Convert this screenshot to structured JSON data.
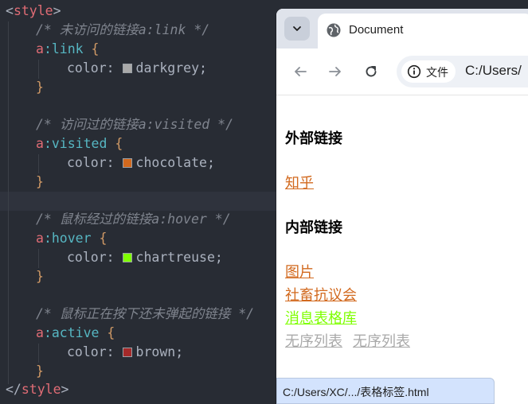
{
  "editor": {
    "lines": {
      "l1": {
        "open": "<",
        "tag": "style",
        "close": ">"
      },
      "l2": {
        "comment": "/* 未访问的链接a:link */"
      },
      "l3": {
        "el": "a",
        "pseudo": ":link",
        "brace": " {"
      },
      "l4": {
        "prop": "color: ",
        "value": "darkgrey;",
        "swatch": "#a9a9a9"
      },
      "l5": {
        "brace": "}"
      },
      "l6": {
        "comment": "/* 访问过的链接a:visited */"
      },
      "l7": {
        "el": "a",
        "pseudo": ":visited",
        "brace": " {"
      },
      "l8": {
        "prop": "color: ",
        "value": "chocolate;",
        "swatch": "#d2691e"
      },
      "l9": {
        "brace": "}"
      },
      "l10": {
        "comment": "/* 鼠标经过的链接a:hover */"
      },
      "l11": {
        "el": "a",
        "pseudo": ":hover",
        "brace": " {"
      },
      "l12": {
        "prop": "color: ",
        "value": "chartreuse;",
        "swatch": "#7fff00"
      },
      "l13": {
        "brace": "}"
      },
      "l14": {
        "comment": "/* 鼠标正在按下还未弹起的链接 */"
      },
      "l15": {
        "el": "a",
        "pseudo": ":active",
        "brace": " {"
      },
      "l16": {
        "prop": "color: ",
        "value": "brown;",
        "swatch": "#a52a2a"
      },
      "l17": {
        "brace": "}"
      },
      "l18": {
        "open": "</",
        "tag": "style",
        "close": ">"
      }
    }
  },
  "browser": {
    "tab": {
      "title": "Document",
      "favicon": "globe-icon",
      "menu_icon": "chevron-down-icon"
    },
    "toolbar": {
      "back_icon": "arrow-left-icon",
      "forward_icon": "arrow-right-icon",
      "reload_icon": "reload-icon",
      "site_info_label": "文件",
      "site_info_icon": "info-icon",
      "url": "C:/Users/"
    },
    "page": {
      "heading_external": "外部链接",
      "link_zhihu": "知乎",
      "heading_internal": "内部链接",
      "link_images": "图片",
      "link_protest": "社畜抗议会",
      "link_table_db": "消息表格库",
      "link_list_1": "无序列表",
      "link_list_2": "无序列表"
    },
    "status_bar": "C:/Users/XC/.../表格标签.html"
  },
  "colors": {
    "editor_bg": "#282c34",
    "tag": "#e06c75",
    "pseudo": "#56b6c2",
    "comment": "#7f848e",
    "visited": "#d2691e",
    "hover": "#7fff00",
    "unvisited": "#a9a9a9",
    "active": "#a52a2a"
  }
}
